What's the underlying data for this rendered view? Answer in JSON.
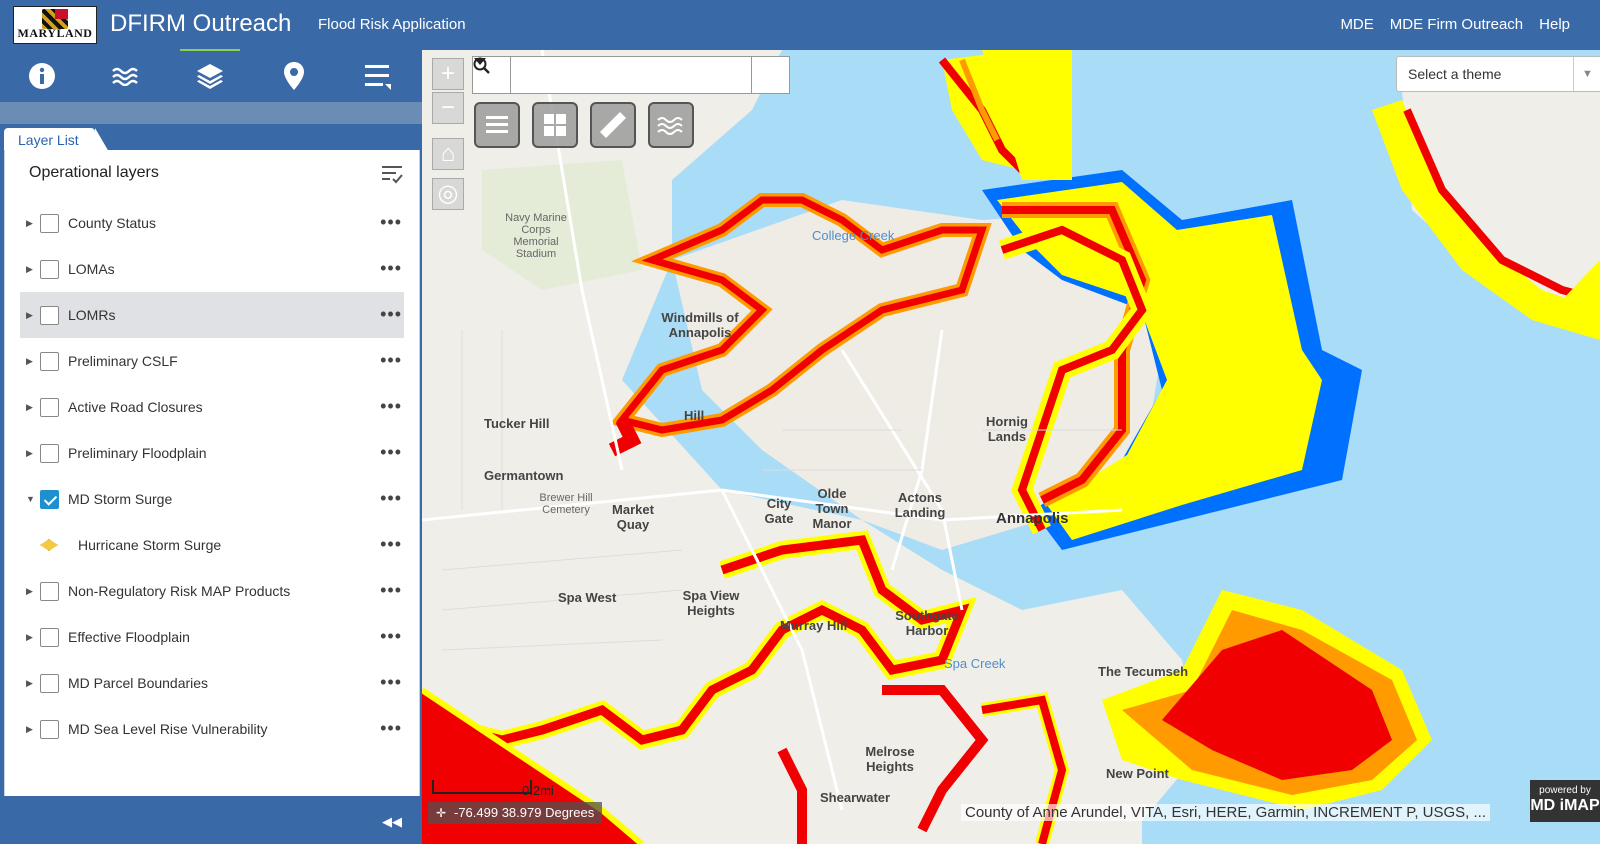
{
  "header": {
    "logo_text": "MARYLAND",
    "title": "DFIRM Outreach",
    "subtitle": "Flood Risk Application",
    "links": [
      "MDE",
      "MDE Firm Outreach",
      "Help"
    ]
  },
  "toolbar": {
    "tools": [
      "info-icon",
      "waves-icon",
      "layers-icon",
      "location-pin-icon",
      "list-menu-icon"
    ],
    "active": "layers-icon"
  },
  "layer_list": {
    "tab_label": "Layer List",
    "heading": "Operational layers",
    "layers": [
      {
        "label": "County Status",
        "checked": false,
        "expanded": false
      },
      {
        "label": "LOMAs",
        "checked": false,
        "expanded": false
      },
      {
        "label": "LOMRs",
        "checked": false,
        "expanded": false,
        "highlighted": true
      },
      {
        "label": "Preliminary CSLF",
        "checked": false,
        "expanded": false
      },
      {
        "label": "Active Road Closures",
        "checked": false,
        "expanded": false
      },
      {
        "label": "Preliminary Floodplain",
        "checked": false,
        "expanded": false
      },
      {
        "label": "MD Storm Surge",
        "checked": true,
        "expanded": true
      },
      {
        "label": "Hurricane Storm Surge",
        "legend": true
      },
      {
        "label": "Non-Regulatory Risk MAP Products",
        "checked": false,
        "expanded": false
      },
      {
        "label": "Effective Floodplain",
        "checked": false,
        "expanded": false
      },
      {
        "label": "MD Parcel Boundaries",
        "checked": false,
        "expanded": false
      },
      {
        "label": "MD Sea Level Rise Vulnerability",
        "checked": false,
        "expanded": false
      }
    ]
  },
  "map": {
    "search_placeholder": "",
    "theme_placeholder": "Select a theme",
    "scale_label": "0.2mi",
    "coordinates": "-76.499 38.979 Degrees",
    "attribution": "County of Anne Arundel, VITA, Esri, HERE, Garmin, INCREMENT P, USGS, ...",
    "powered_by": "powered by",
    "powered_brand": "MD iMAP",
    "labels": {
      "tucker_hill": "Tucker Hill",
      "germantown": "Germantown",
      "windmills": "Windmills of Annapolis",
      "market_quay": "Market Quay",
      "city_gate": "City Gate",
      "olde_town": "Olde Town Manor",
      "actons": "Actons Landing",
      "annapolis": "Annapolis",
      "hornig": "Hornig Lands",
      "spa_west": "Spa West",
      "spa_view": "Spa View Heights",
      "murray_hill": "Murray Hill",
      "southgate": "Southgate Harbor",
      "tecumseh": "The Tecumseh",
      "new_point": "New Point",
      "spa_creek": "Spa Creek",
      "college_creek": "College Creek",
      "navy": "Navy Marine Corps Memorial Stadium",
      "brewer": "Brewer Hill Cemetery",
      "melrose": "Melrose Heights",
      "shearwater": "Shearwater",
      "hill": "Hill"
    }
  },
  "colors": {
    "header_bg": "#3a69a8",
    "surge_red": "#f00000",
    "surge_orange": "#ff9a00",
    "surge_yellow": "#ffff00",
    "surge_blue": "#0070ff",
    "water": "#a9dcf7"
  }
}
